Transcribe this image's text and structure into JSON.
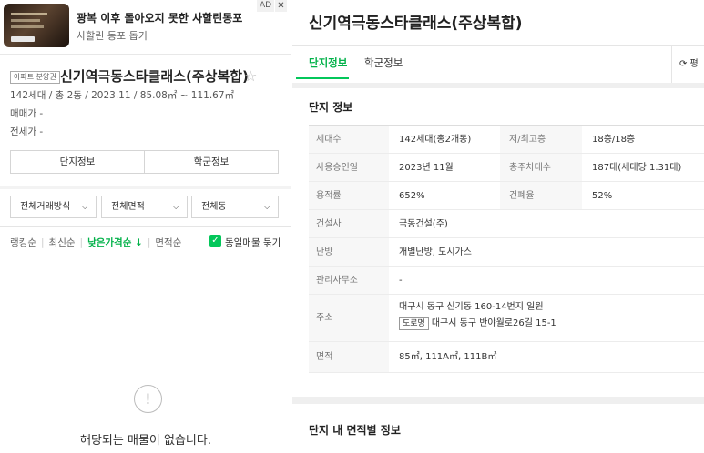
{
  "ad": {
    "badge": "AD",
    "close_icon": "close-icon",
    "title": "광복 이후 돌아오지 못한 사할린동포",
    "subtitle": "사할린 동포 돕기"
  },
  "complex": {
    "type_badge": "아파트 분양권",
    "name": "신기역극동스타클래스(주상복합)",
    "favorite_icon": "star-outline-icon",
    "summary": "142세대 / 총 2동 / 2023.11 / 85.08㎡ ~ 111.67㎡",
    "sale_price": "매매가 -",
    "jeonse_price": "전세가 -"
  },
  "left_tabs": [
    "단지정보",
    "학군정보"
  ],
  "filters": [
    {
      "label": "전체거래방식",
      "icon": "chevron-down-icon"
    },
    {
      "label": "전체면적",
      "icon": "chevron-down-icon"
    },
    {
      "label": "전체동",
      "icon": "chevron-down-icon"
    }
  ],
  "sort": {
    "items": [
      "랭킹순",
      "최신순",
      "낮은가격순 ↓",
      "면적순"
    ],
    "active_index": 2,
    "same_listing_label": "동일매물 묶기",
    "same_listing_checked": true
  },
  "empty": {
    "icon": "exclamation-circle-icon",
    "message": "해당되는 매물이 없습니다."
  },
  "detail": {
    "title": "신기역극동스타클래스(주상복합)",
    "tabs": [
      "단지정보",
      "학군정보"
    ],
    "active_tab": 0,
    "right_box_label": "⟳ 평",
    "section_info_title": "단지 정보",
    "info": {
      "units_key": "세대수",
      "units_val": "142세대(총2개동)",
      "floors_key": "저/최고층",
      "floors_val": "18층/18층",
      "approval_key": "사용승인일",
      "approval_val": "2023년 11월",
      "parking_key": "총주차대수",
      "parking_val": "187대(세대당 1.31대)",
      "far_key": "용적률",
      "far_val": "652%",
      "bcr_key": "건폐율",
      "bcr_val": "52%",
      "builder_key": "건설사",
      "builder_val": "극동건설(주)",
      "heating_key": "난방",
      "heating_val": "개별난방, 도시가스",
      "office_key": "관리사무소",
      "office_val": "-",
      "address_key": "주소",
      "address_lot": "대구시 동구 신기동 160-14번지 일원",
      "road_badge": "도로명",
      "address_road": "대구시 동구 반야월로26길 15-1",
      "area_key": "면적",
      "area_val": "85㎡, 111A㎡, 111B㎡"
    },
    "section_area_title": "단지 내 면적별 정보"
  },
  "colors": {
    "accent_green": "#03c75a",
    "active_text_green": "#03b24a"
  }
}
